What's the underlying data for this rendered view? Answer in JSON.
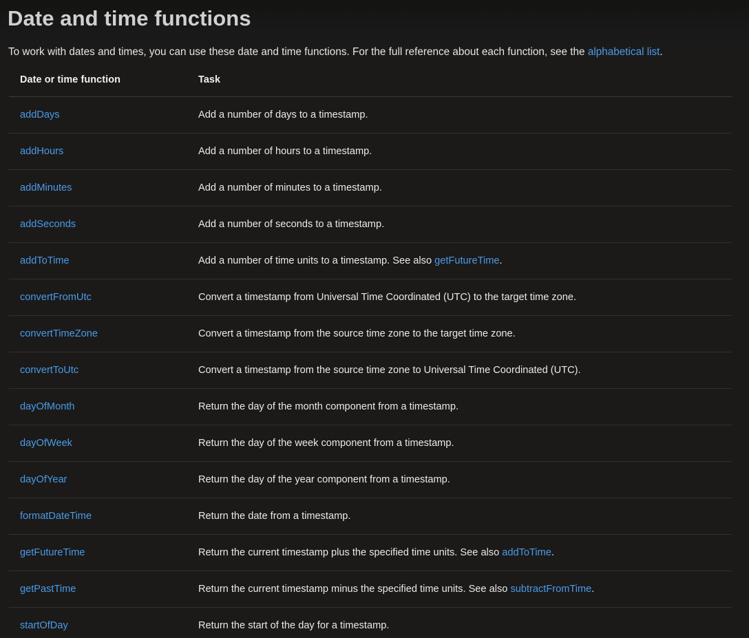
{
  "page": {
    "title": "Date and time functions",
    "intro": {
      "before_link": "To work with dates and times, you can use these date and time functions. For the full reference about each function, see the ",
      "link_text": "alphabetical list",
      "after_link": "."
    }
  },
  "colors": {
    "background": "#1b1a19",
    "link": "#4a9be8",
    "title": "#d2d0ce",
    "body_text": "#e8e8e8",
    "row_border": "#332f2f",
    "header_border": "#3a3938"
  },
  "table": {
    "columns": [
      {
        "label": "Date or time function"
      },
      {
        "label": "Task"
      }
    ],
    "rows": [
      {
        "function": "addDays",
        "task_before": "Add a number of days to a timestamp.",
        "task_link": "",
        "task_after": ""
      },
      {
        "function": "addHours",
        "task_before": "Add a number of hours to a timestamp.",
        "task_link": "",
        "task_after": ""
      },
      {
        "function": "addMinutes",
        "task_before": "Add a number of minutes to a timestamp.",
        "task_link": "",
        "task_after": ""
      },
      {
        "function": "addSeconds",
        "task_before": "Add a number of seconds to a timestamp.",
        "task_link": "",
        "task_after": ""
      },
      {
        "function": "addToTime",
        "task_before": "Add a number of time units to a timestamp. See also ",
        "task_link": "getFutureTime",
        "task_after": "."
      },
      {
        "function": "convertFromUtc",
        "task_before": "Convert a timestamp from Universal Time Coordinated (UTC) to the target time zone.",
        "task_link": "",
        "task_after": ""
      },
      {
        "function": "convertTimeZone",
        "task_before": "Convert a timestamp from the source time zone to the target time zone.",
        "task_link": "",
        "task_after": ""
      },
      {
        "function": "convertToUtc",
        "task_before": "Convert a timestamp from the source time zone to Universal Time Coordinated (UTC).",
        "task_link": "",
        "task_after": ""
      },
      {
        "function": "dayOfMonth",
        "task_before": "Return the day of the month component from a timestamp.",
        "task_link": "",
        "task_after": ""
      },
      {
        "function": "dayOfWeek",
        "task_before": "Return the day of the week component from a timestamp.",
        "task_link": "",
        "task_after": ""
      },
      {
        "function": "dayOfYear",
        "task_before": "Return the day of the year component from a timestamp.",
        "task_link": "",
        "task_after": ""
      },
      {
        "function": "formatDateTime",
        "task_before": "Return the date from a timestamp.",
        "task_link": "",
        "task_after": ""
      },
      {
        "function": "getFutureTime",
        "task_before": "Return the current timestamp plus the specified time units. See also ",
        "task_link": "addToTime",
        "task_after": "."
      },
      {
        "function": "getPastTime",
        "task_before": "Return the current timestamp minus the specified time units. See also ",
        "task_link": "subtractFromTime",
        "task_after": "."
      },
      {
        "function": "startOfDay",
        "task_before": "Return the start of the day for a timestamp.",
        "task_link": "",
        "task_after": ""
      }
    ]
  }
}
